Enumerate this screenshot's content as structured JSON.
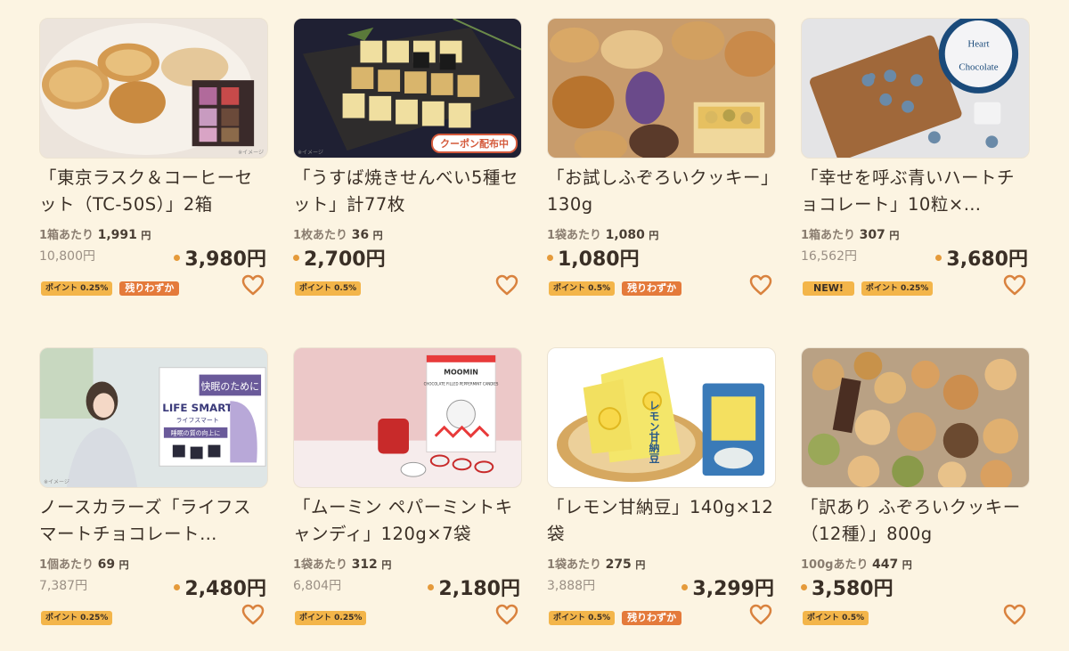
{
  "products": [
    {
      "title": "「東京ラスク＆コーヒーセット（TC-50S）」2箱",
      "unit_label": "1箱あたり",
      "unit_price": "1,991",
      "unit_yen": "円",
      "original_price": "10,800円",
      "price": "3,980円",
      "badges": [
        {
          "kind": "point",
          "text": "ポイント 0.25%"
        },
        {
          "kind": "few",
          "text": "残りわずか"
        }
      ],
      "image_icon": "rusk-coffee-gift-image",
      "note": "※イメージ",
      "coupon": ""
    },
    {
      "title": "「うすば焼きせんべい5種セット」計77枚",
      "unit_label": "1枚あたり",
      "unit_price": "36",
      "unit_yen": "円",
      "original_price": "",
      "price": "2,700円",
      "badges": [
        {
          "kind": "point",
          "text": "ポイント 0.5%"
        }
      ],
      "image_icon": "senbei-image",
      "note": "※イメージ",
      "coupon": "クーポン配布中"
    },
    {
      "title": "「お試しふぞろいクッキー」130g",
      "unit_label": "1袋あたり",
      "unit_price": "1,080",
      "unit_yen": "円",
      "original_price": "",
      "price": "1,080円",
      "badges": [
        {
          "kind": "point",
          "text": "ポイント 0.5%"
        },
        {
          "kind": "few",
          "text": "残りわずか"
        }
      ],
      "image_icon": "cookie-box-image",
      "note": "",
      "coupon": ""
    },
    {
      "title": "「幸せを呼ぶ青いハートチョコレート」10粒×…",
      "unit_label": "1箱あたり",
      "unit_price": "307",
      "unit_yen": "円",
      "original_price": "16,562円",
      "price": "3,680円",
      "badges": [
        {
          "kind": "new",
          "text": "NEW!"
        },
        {
          "kind": "point",
          "text": "ポイント 0.25%"
        }
      ],
      "image_icon": "heart-chocolate-image",
      "note": "",
      "coupon": "",
      "package_text": [
        "Heart",
        "Chocolate"
      ]
    },
    {
      "title": "ノースカラーズ「ライフスマートチョコレート…",
      "unit_label": "1個あたり",
      "unit_price": "69",
      "unit_yen": "円",
      "original_price": "7,387円",
      "price": "2,480円",
      "badges": [
        {
          "kind": "point",
          "text": "ポイント 0.25%"
        }
      ],
      "image_icon": "life-smart-image",
      "note": "※イメージ",
      "coupon": "",
      "package_text": [
        "快眠のために",
        "LIFE SMART",
        "ライフスマート",
        "睡眠の質の向上に"
      ]
    },
    {
      "title": "「ムーミン ペパーミントキャンディ」120g×7袋",
      "unit_label": "1袋あたり",
      "unit_price": "312",
      "unit_yen": "円",
      "original_price": "6,804円",
      "price": "2,180円",
      "badges": [
        {
          "kind": "point",
          "text": "ポイント 0.25%"
        }
      ],
      "image_icon": "moomin-candy-image",
      "note": "",
      "coupon": "",
      "package_text": [
        "MOOMIN",
        "CHOCOLATE FILLED PEPPERMINT CANDIES"
      ]
    },
    {
      "title": "「レモン甘納豆」140g×12袋",
      "unit_label": "1袋あたり",
      "unit_price": "275",
      "unit_yen": "円",
      "original_price": "3,888円",
      "price": "3,299円",
      "badges": [
        {
          "kind": "point",
          "text": "ポイント 0.5%"
        },
        {
          "kind": "few",
          "text": "残りわずか"
        }
      ],
      "image_icon": "lemon-amanatto-image",
      "note": "",
      "coupon": "",
      "package_text": [
        "レモン甘納豆"
      ]
    },
    {
      "title": "「訳あり ふぞろいクッキー（12種）」800g",
      "unit_label": "100gあたり",
      "unit_price": "447",
      "unit_yen": "円",
      "original_price": "",
      "price": "3,580円",
      "badges": [
        {
          "kind": "point",
          "text": "ポイント 0.5%"
        }
      ],
      "image_icon": "assorted-cookies-image",
      "note": "",
      "coupon": ""
    }
  ],
  "colors": {
    "background": "#fcf4e2",
    "price_dot": "#e59a3a",
    "point_badge": "#f3b54a",
    "few_badge": "#e47a3b",
    "heart": "#d9823e"
  },
  "icons": {
    "favorite": "heart-outline-icon"
  }
}
